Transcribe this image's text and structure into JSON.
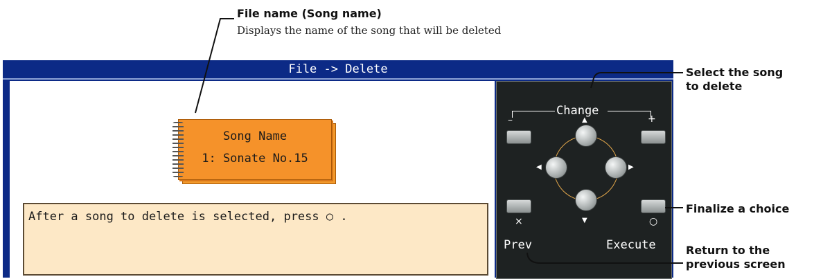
{
  "callouts": {
    "file_name_title": "File name (Song name)",
    "file_name_desc": "Displays the name of the song that will be deleted",
    "select_song_line1": "Select the song",
    "select_song_line2": "to delete",
    "finalize": "Finalize a choice",
    "return_line1": "Return to the",
    "return_line2": "previous screen"
  },
  "screen": {
    "title": "File -> Delete",
    "song_card": {
      "label": "Song Name",
      "value": "1: Sonate No.15"
    },
    "message": "After a song to delete is selected, press ○ ."
  },
  "panel": {
    "group_label": "Change",
    "minus_label": "–",
    "plus_label": "+",
    "cancel_mark": "×",
    "ok_mark": "○",
    "prev_label": "Prev",
    "execute_label": "Execute",
    "arrows": {
      "up": "▲",
      "down": "▼",
      "left": "◀",
      "right": "▶"
    }
  },
  "colors": {
    "screen_frame": "#0c2a86",
    "song_card": "#f5922a",
    "message_bg": "#fde8c6",
    "panel_bg": "#1e2222"
  }
}
